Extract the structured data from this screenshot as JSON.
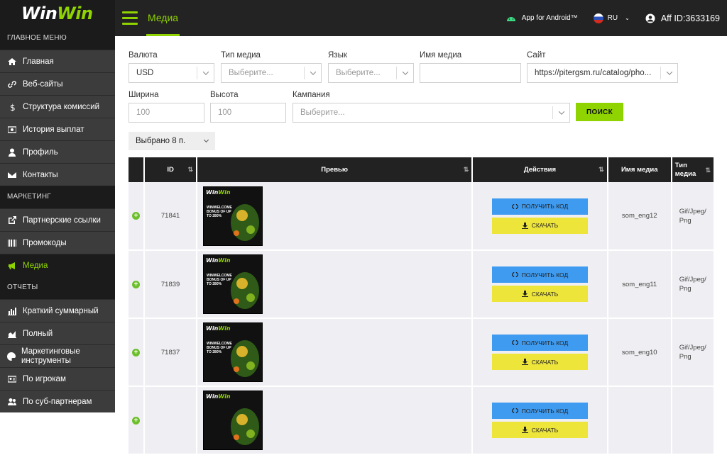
{
  "brand": {
    "logo_a": "Win",
    "logo_b": "Win"
  },
  "sidebar": {
    "sections": [
      "ГЛАВНОЕ МЕНЮ",
      "МАРКЕТИНГ",
      "ОТЧЕТЫ"
    ],
    "items": [
      {
        "label": "Главная",
        "icon": "home-icon"
      },
      {
        "label": "Веб-сайты",
        "icon": "link-icon"
      },
      {
        "label": "Структура комиссий",
        "icon": "dollar-icon"
      },
      {
        "label": "История выплат",
        "icon": "cash-icon"
      },
      {
        "label": "Профиль",
        "icon": "user-icon"
      },
      {
        "label": "Контакты",
        "icon": "envelope-icon"
      },
      {
        "label": "Партнерские ссылки",
        "icon": "external-link-icon"
      },
      {
        "label": "Промокоды",
        "icon": "barcode-icon"
      },
      {
        "label": "Медиа",
        "icon": "megaphone-icon"
      },
      {
        "label": "Краткий суммарный",
        "icon": "bar-chart-icon"
      },
      {
        "label": "Полный",
        "icon": "area-chart-icon"
      },
      {
        "label": "Маркетинговые инструменты",
        "icon": "palette-icon"
      },
      {
        "label": "По игрокам",
        "icon": "id-card-icon"
      },
      {
        "label": "По суб-партнерам",
        "icon": "users-icon"
      }
    ]
  },
  "header": {
    "title": "Медиа",
    "android": "App for Android™",
    "lang": "RU",
    "aff": "Aff ID:3633169"
  },
  "filters": {
    "currency_label": "Валюта",
    "currency_value": "USD",
    "media_type_label": "Тип медиа",
    "media_type_placeholder": "Выберите...",
    "lang_label": "Язык",
    "lang_placeholder": "Выберите...",
    "media_name_label": "Имя медиа",
    "site_label": "Сайт",
    "site_value": "https://pitergsm.ru/catalog/pho...",
    "width_label": "Ширина",
    "width_placeholder": "100",
    "height_label": "Высота",
    "height_placeholder": "100",
    "campaign_label": "Кампания",
    "campaign_placeholder": "Выберите...",
    "search_button": "ПОИСК",
    "chosen": "Выбрано 8 п."
  },
  "table": {
    "headers": {
      "id": "ID",
      "preview": "Превью",
      "actions": "Действия",
      "name": "Имя медиа",
      "type": "Тип медиа"
    },
    "get_code": "ПОЛУЧИТЬ КОД",
    "download": "СКАЧАТЬ",
    "preview_logo_a": "Win",
    "preview_logo_b": "Win",
    "rows": [
      {
        "id": "71841",
        "name": "som_eng12",
        "type": "Gif/Jpeg/ Png",
        "promo": "WINWELCOME BONUS OF UP TO 280%"
      },
      {
        "id": "71839",
        "name": "som_eng11",
        "type": "Gif/Jpeg/ Png",
        "promo": "WINWELCOME BONUS OF UP TO 280%"
      },
      {
        "id": "71837",
        "name": "som_eng10",
        "type": "Gif/Jpeg/ Png",
        "promo": "WINWELCOME BONUS OF UP TO 280%"
      },
      {
        "id": "",
        "name": "",
        "type": "",
        "promo": ""
      }
    ]
  },
  "colors": {
    "accent": "#8fd400",
    "code_btn": "#3f9bf0",
    "download_btn": "#eee53a"
  }
}
